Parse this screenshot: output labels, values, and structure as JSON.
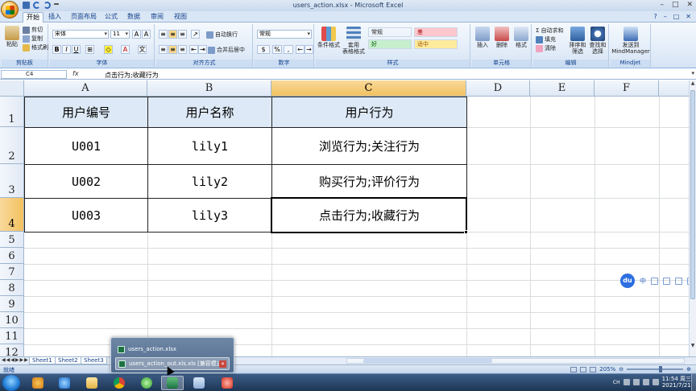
{
  "window": {
    "title": "users_action.xlsx - Microsoft Excel",
    "controls": [
      "–",
      "□",
      "✕"
    ]
  },
  "ribbon": {
    "tabs": [
      "开始",
      "插入",
      "页面布局",
      "公式",
      "数据",
      "审阅",
      "视图"
    ],
    "active_tab": "开始",
    "right_controls": [
      "?",
      "–",
      "□",
      "✕"
    ],
    "clipboard": {
      "paste": "粘贴",
      "cut": "剪切",
      "copy": "复制",
      "format_painter": "格式刷",
      "label": "剪贴板"
    },
    "font": {
      "name": "宋体",
      "size": "11",
      "label": "字体"
    },
    "alignment": {
      "wrap": "自动换行",
      "merge": "合并后居中",
      "label": "对齐方式"
    },
    "number": {
      "format": "常规",
      "label": "数字",
      "percent": "%",
      "comma": ","
    },
    "styles": {
      "conditional": "条件格式",
      "table": "套用\n表格格式",
      "cells_style": [
        {
          "name": "常规",
          "bg": "#ffffff"
        },
        {
          "name": "差",
          "bg": "#ffc7ce"
        },
        {
          "name": "好",
          "bg": "#c6efce"
        },
        {
          "name": "适中",
          "bg": "#ffeb9c"
        }
      ],
      "label": "样式"
    },
    "cells": {
      "insert": "插入",
      "delete": "删除",
      "format": "格式",
      "label": "单元格"
    },
    "editing": {
      "autosum": "自动求和",
      "fill": "填充",
      "clear": "清除",
      "sort": "排序和\n筛选",
      "find": "查找和\n选择",
      "label": "编辑"
    },
    "mindjet": {
      "send": "发送到\nMindManager",
      "label": "Mindjet"
    }
  },
  "formula_bar": {
    "name_box": "C4",
    "fx": "fx",
    "content": "点击行为;收藏行为"
  },
  "sheet": {
    "columns": [
      "A",
      "B",
      "C",
      "D",
      "E",
      "F"
    ],
    "selected_column": "C",
    "rows": [
      "1",
      "2",
      "3",
      "4",
      "5",
      "6",
      "7",
      "8",
      "9",
      "10",
      "11",
      "12"
    ],
    "selected_row": "4",
    "header": [
      "用户编号",
      "用户名称",
      "用户行为"
    ],
    "data": [
      [
        "U001",
        "lily1",
        "浏览行为;关注行为"
      ],
      [
        "U002",
        "lily2",
        "购买行为;评价行为"
      ],
      [
        "U003",
        "lily3",
        "点击行为;收藏行为"
      ]
    ],
    "header_fill": "#dde9f6"
  },
  "float_toolbar": {
    "badge": "du",
    "lang": "中"
  },
  "sheet_tabs": [
    "Sheet1",
    "Sheet2",
    "Sheet3"
  ],
  "status": {
    "mode": "就绪",
    "zoom": "205%",
    "zoom_level": 0.6
  },
  "taskbar": {
    "thumbnail_popup": [
      {
        "label": "users_action.xlsx",
        "hover": false
      },
      {
        "label": "users_action_out.xls.xls  [兼容模式]",
        "hover": true
      }
    ],
    "tray": {
      "lang": "CH",
      "time": "11:54 周三",
      "date": "2021/7/21"
    }
  }
}
